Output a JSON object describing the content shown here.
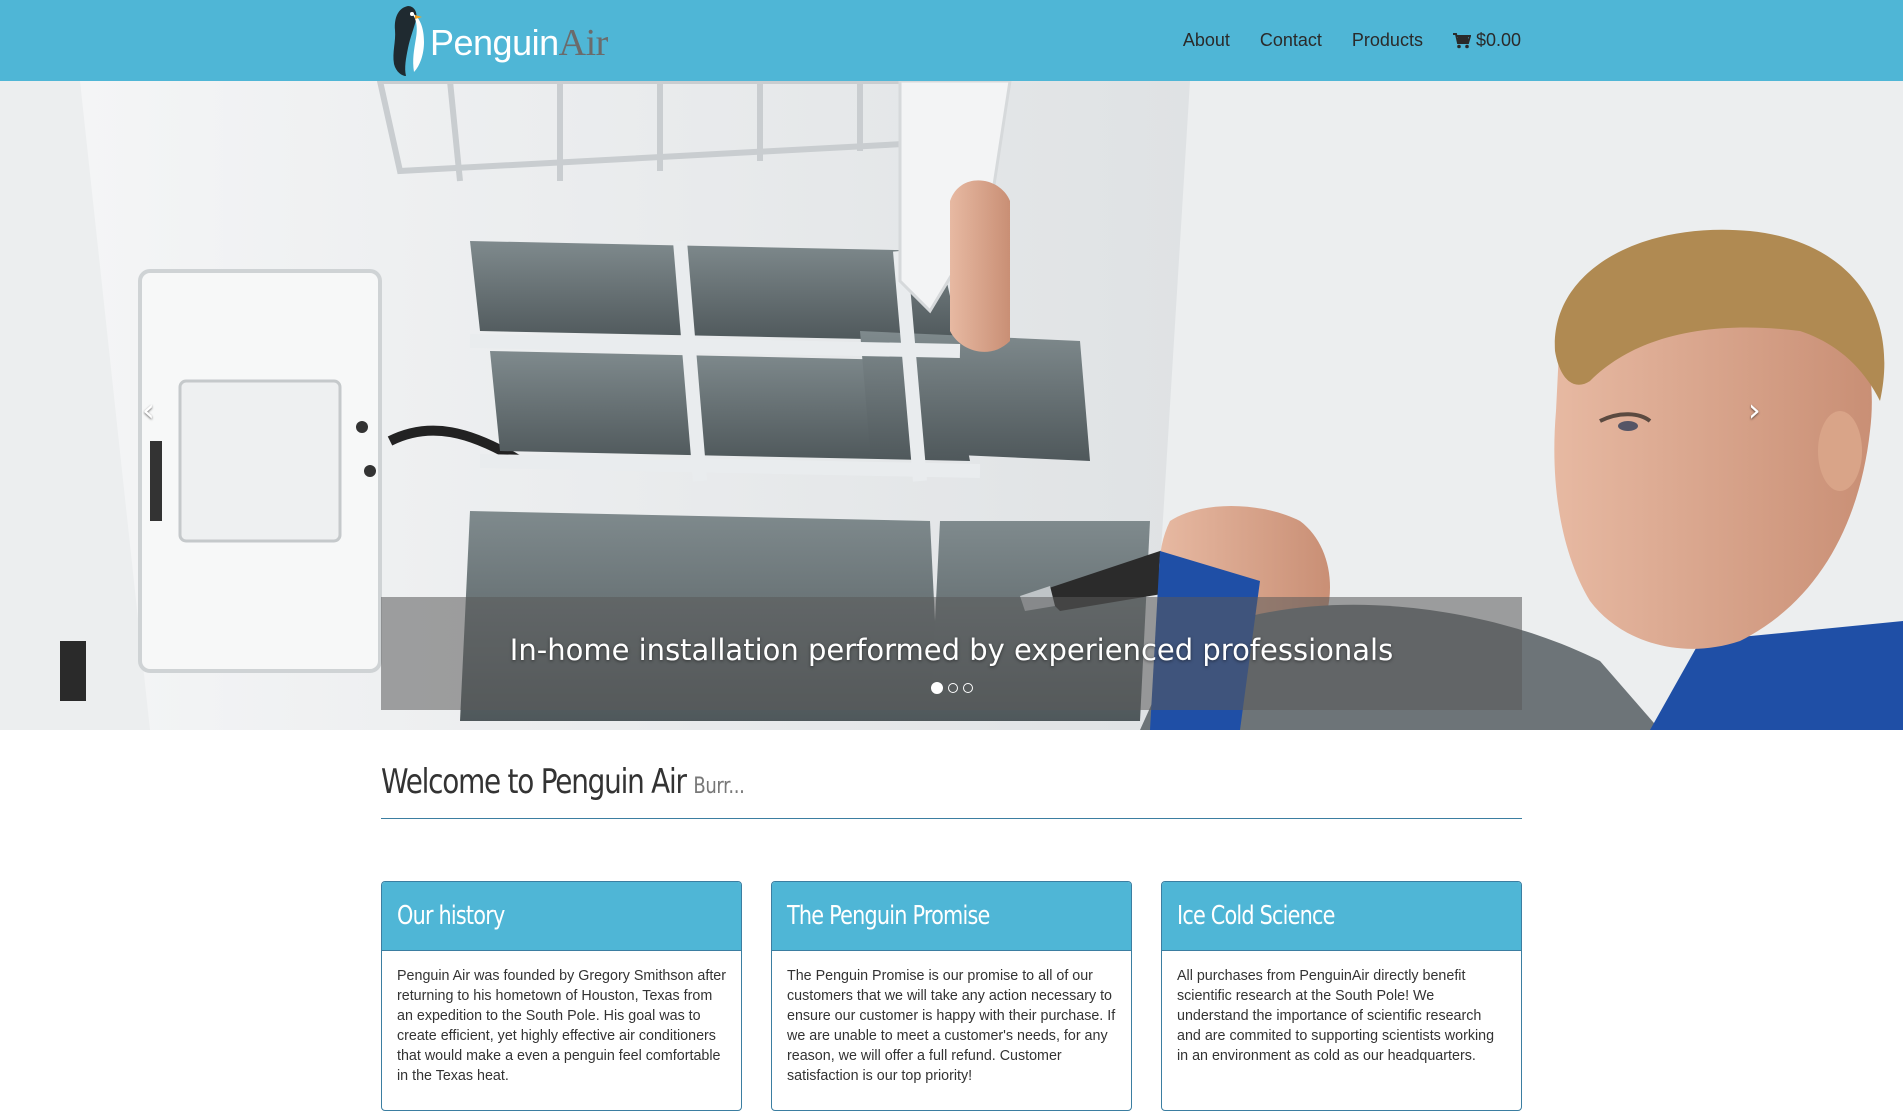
{
  "brand": {
    "name_part1": "Penguin",
    "name_part2": "Air",
    "logo_icon": "penguin-icon"
  },
  "nav": {
    "items": [
      {
        "label": "About"
      },
      {
        "label": "Contact"
      },
      {
        "label": "Products"
      }
    ],
    "cart": {
      "icon": "cart-icon",
      "label": "$0.00"
    }
  },
  "carousel": {
    "caption": "In-home installation performed by experienced professionals",
    "prev_symbol": "‹",
    "next_symbol": "›",
    "slide_count": 3,
    "active_slide": 1
  },
  "welcome": {
    "title": "Welcome to Penguin Air",
    "subtitle": "Burr..."
  },
  "cards": [
    {
      "title": "Our history",
      "body": "Penguin Air was founded by Gregory Smithson after returning to his hometown of Houston, Texas from an expedition to the South Pole. His goal was to create efficient, yet highly effective air conditioners that would make a even a penguin feel comfortable in the Texas heat."
    },
    {
      "title": "The Penguin Promise",
      "body": "The Penguin Promise is our promise to all of our customers that we will take any action necessary to ensure our customer is happy with their purchase. If we are unable to meet a customer's needs, for any reason, we will offer a full refund. Customer satisfaction is our top priority!"
    },
    {
      "title": "Ice Cold Science",
      "body": "All purchases from PenguinAir directly benefit scientific research at the South Pole! We understand the importance of scientific research and are commited to supporting scientists working in an environment as cold as our headquarters."
    }
  ],
  "colors": {
    "brand_blue": "#4fb6d6",
    "border_blue": "#3b7ea1"
  }
}
